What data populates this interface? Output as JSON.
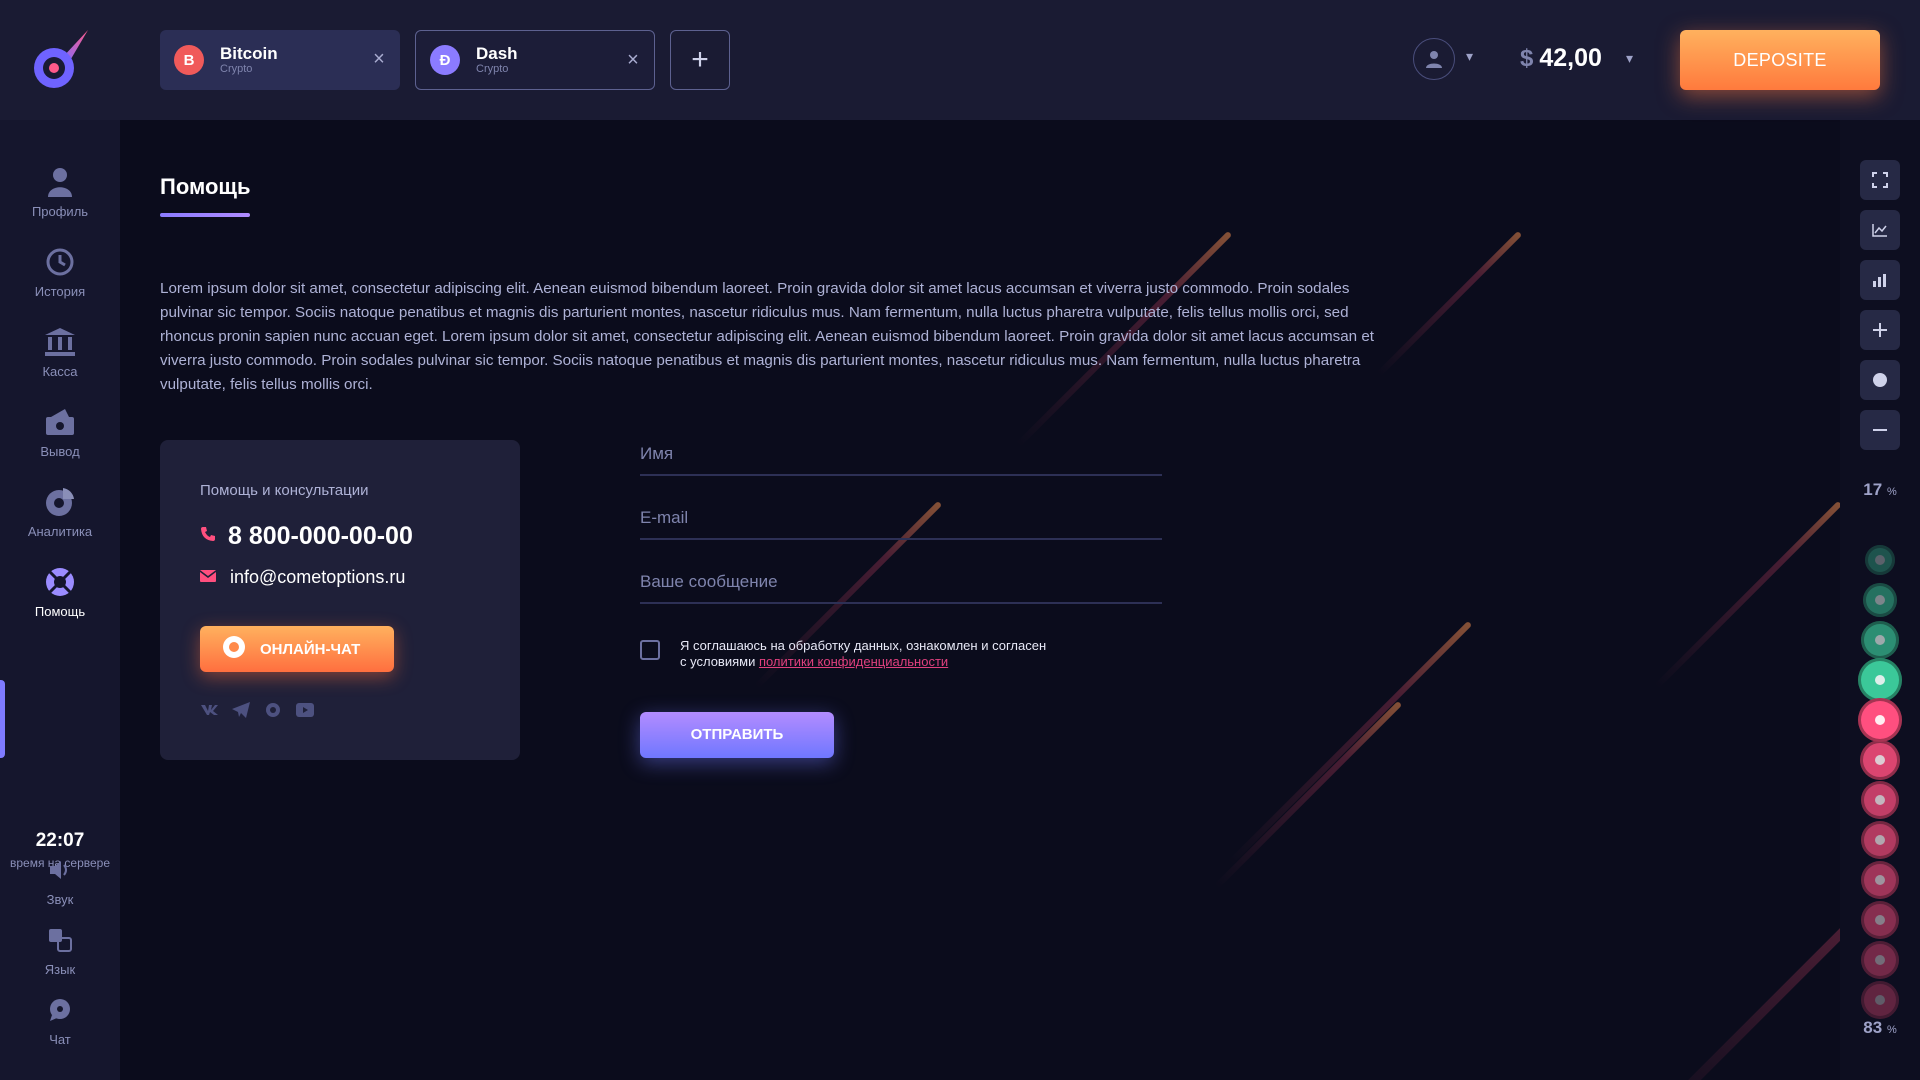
{
  "header": {
    "tabs": [
      {
        "name": "Bitcoin",
        "type": "Crypto",
        "symbol": "B",
        "color": "#f05a5a"
      },
      {
        "name": "Dash",
        "type": "Crypto",
        "symbol": "Đ",
        "color": "#8b7bff"
      }
    ],
    "close_glyph": "×",
    "add_glyph": "+",
    "balance_currency": "$",
    "balance_amount": "42,00",
    "deposit_label": "DEPOSITE"
  },
  "sidebar": {
    "items": [
      {
        "label": "Профиль",
        "icon": "user-icon"
      },
      {
        "label": "История",
        "icon": "history-icon"
      },
      {
        "label": "Касса",
        "icon": "bank-icon"
      },
      {
        "label": "Вывод",
        "icon": "wallet-icon"
      },
      {
        "label": "Аналитика",
        "icon": "analytics-icon"
      },
      {
        "label": "Помощь",
        "icon": "help-icon"
      }
    ],
    "active_item": "Помощь",
    "server_time": "22:07",
    "server_time_label": "время на сервере",
    "bottom_items": [
      {
        "label": "Звук",
        "icon": "sound-icon"
      },
      {
        "label": "Язык",
        "icon": "language-icon"
      },
      {
        "label": "Чат",
        "icon": "chat-icon"
      }
    ]
  },
  "main": {
    "title": "Помощь",
    "intro": "Lorem ipsum dolor sit amet, consectetur adipiscing elit. Aenean euismod bibendum laoreet. Proin gravida dolor sit amet lacus accumsan et viverra justo commodo. Proin sodales pulvinar sic tempor. Sociis natoque penatibus et magnis dis parturient montes, nascetur ridiculus mus. Nam fermentum, nulla luctus pharetra vulputate, felis tellus mollis orci, sed rhoncus pronin sapien nunc accuan eget. Lorem ipsum dolor sit amet, consectetur adipiscing elit. Aenean euismod bibendum laoreet. Proin gravida dolor sit amet lacus accumsan et viverra justo commodo. Proin sodales pulvinar sic tempor. Sociis natoque penatibus et magnis dis parturient montes, nascetur ridiculus mus. Nam fermentum, nulla luctus pharetra vulputate, felis tellus mollis orci.",
    "contact": {
      "title": "Помощь и консультации",
      "phone": "8 800-000-00-00",
      "email": "info@cometoptions.ru",
      "chat_label": "ОНЛАЙН-ЧАТ",
      "socials": [
        "vk-icon",
        "telegram-icon",
        "messenger-icon",
        "youtube-icon"
      ]
    },
    "form": {
      "name_placeholder": "Имя",
      "email_placeholder": "E-mail",
      "message_placeholder": "Ваше сообщение",
      "agree_text_1": "Я соглашаюсь на обработку данных, ознакомлен и согласен",
      "agree_text_2": "с условиями ",
      "agree_link": "политики конфиденциальности",
      "submit_label": "ОТПРАВИТЬ"
    }
  },
  "rail": {
    "buttons": [
      "fullscreen-icon",
      "line-chart-icon",
      "bar-chart-icon",
      "plus-icon",
      "dot-icon",
      "minus-icon"
    ],
    "top_percent": "17",
    "bottom_percent": "83",
    "percent_unit": "%",
    "green_color": "#3ed3a0",
    "red_color": "#ff4f7f"
  }
}
